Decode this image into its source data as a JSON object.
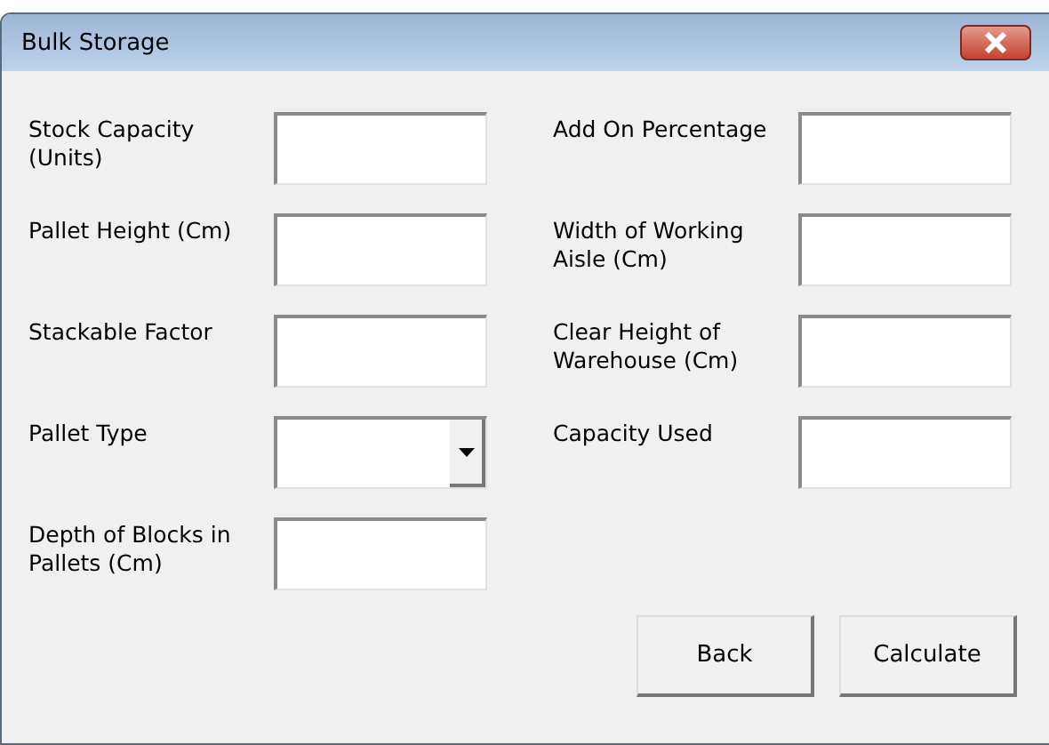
{
  "window": {
    "title": "Bulk Storage"
  },
  "columns": [
    [
      {
        "label": "Stock Capacity (Units)",
        "kind": "text"
      },
      {
        "label": "Pallet Height (Cm)",
        "kind": "text"
      },
      {
        "label": "Stackable Factor",
        "kind": "text"
      },
      {
        "label": "Pallet Type",
        "kind": "dropdown"
      },
      {
        "label": "Depth of Blocks in Pallets (Cm)",
        "kind": "text"
      }
    ],
    [
      {
        "label": "Add On Percentage",
        "kind": "text"
      },
      {
        "label": "Width of Working Aisle (Cm)",
        "kind": "text"
      },
      {
        "label": "Clear Height of Warehouse (Cm)",
        "kind": "text"
      },
      {
        "label": "Capacity Used",
        "kind": "text"
      }
    ]
  ],
  "buttons": [
    "Back",
    "Calculate"
  ]
}
